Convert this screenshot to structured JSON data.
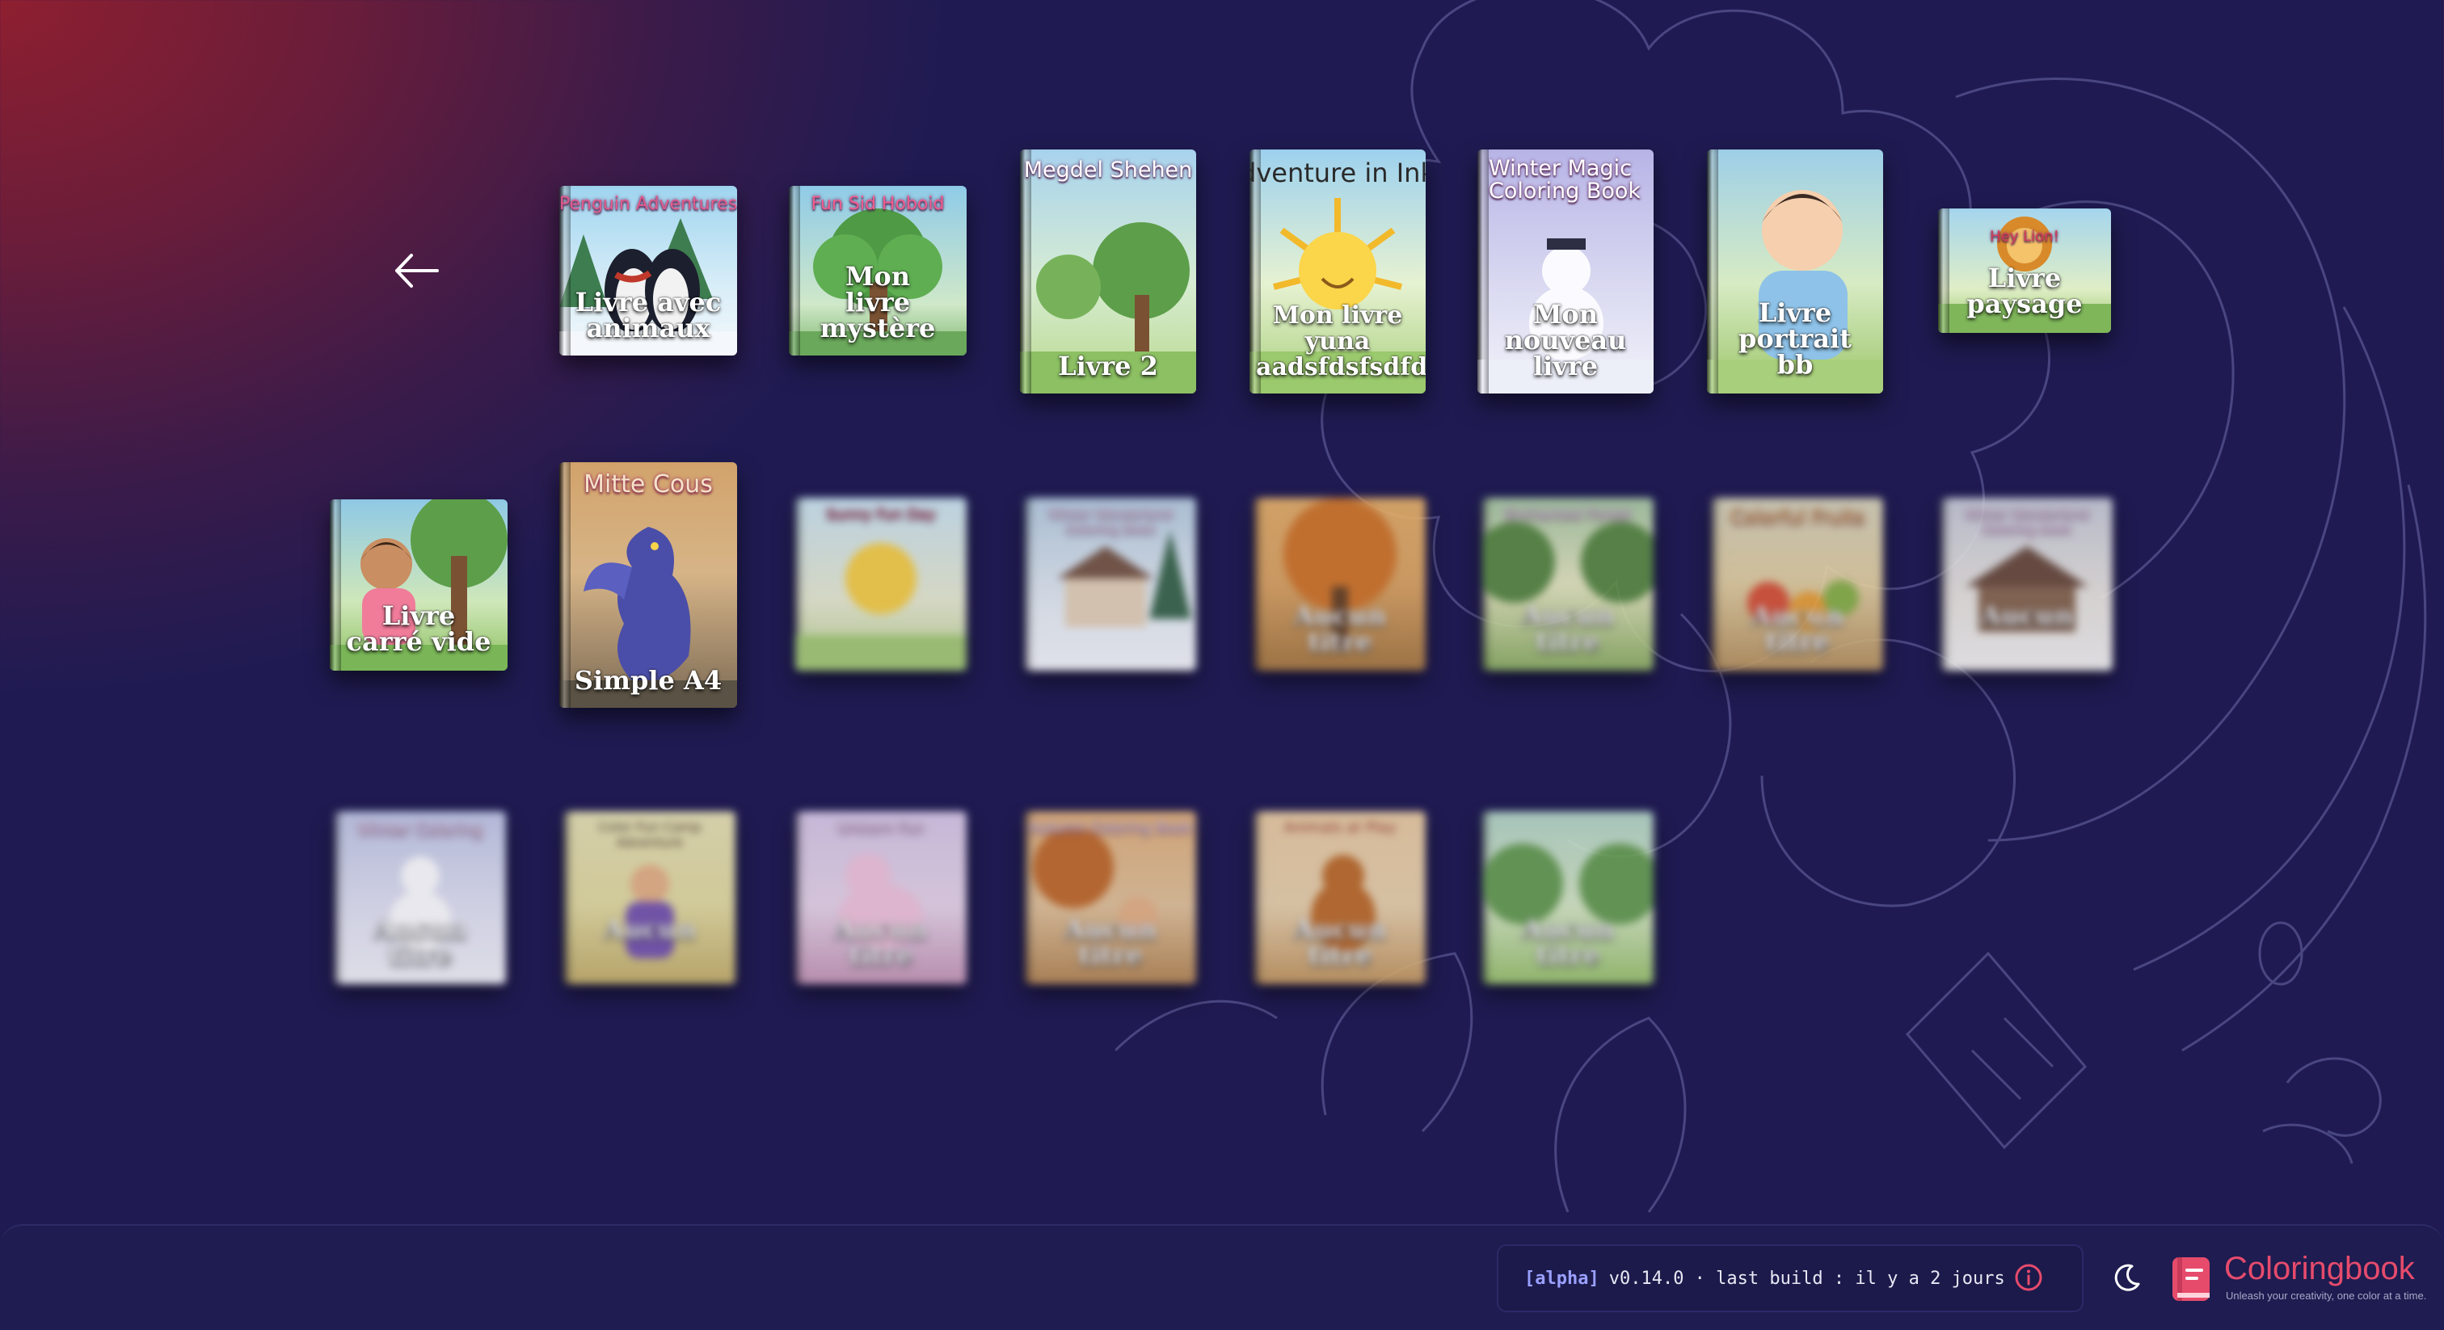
{
  "back_label": "back",
  "books": {
    "row1": [
      {
        "label": "Livre avec\nanimaux",
        "cover_title": "Penguin Adventures"
      },
      {
        "label": "Mon\nlivre\nmystère",
        "cover_title": "Fun Sid Hoboid"
      },
      {
        "label": "Livre 2",
        "cover_title": "Megdel Shehen"
      },
      {
        "label": "Mon livre\nyuna\naadsfdsfsdfds",
        "cover_title": "dventure in Ink"
      },
      {
        "label": "Mon\nnouveau\nlivre",
        "cover_title": "Winter Magic\nColoring Book"
      },
      {
        "label": "Livre\nportrait\nbb",
        "cover_title": ""
      },
      {
        "label": "Livre\npaysage",
        "cover_title": "Hey Lion!"
      }
    ],
    "row2": [
      {
        "label": "Livre\ncarré vide",
        "cover_title": ""
      },
      {
        "label": "Simple A4",
        "cover_title": "Mitte Cous"
      },
      {
        "label": "",
        "cover_title": "Sunny Fun Day"
      },
      {
        "label": "",
        "cover_title": "Winter Wonderland Coloring Book"
      },
      {
        "label": "Aucun titre",
        "cover_title": ""
      },
      {
        "label": "Aucun titre",
        "cover_title": "Enchanted Forest"
      },
      {
        "label": "Aucun titre",
        "cover_title": "Colorful Fruits"
      },
      {
        "label": "Aucun",
        "cover_title": "Winter Wonderland Coloring book"
      }
    ],
    "row3": [
      {
        "label": "Aucun titre",
        "cover_title": "Winter Coloring"
      },
      {
        "label": "Aucun",
        "cover_title": "Color Fun Camp Adventure"
      },
      {
        "label": "Aucun titre",
        "cover_title": "Unicorn Fun"
      },
      {
        "label": "Aucun titre",
        "cover_title": "Autumn Coloring Book"
      },
      {
        "label": "Aucun titre",
        "cover_title": "Animals at Play"
      },
      {
        "label": "Aucun titre",
        "cover_title": ""
      }
    ]
  },
  "footer": {
    "alpha_tag": "[alpha]",
    "version_text": "v0.14.0 · last build : il y a 2 jours",
    "brand_name": "Coloringbook",
    "brand_tagline": "Unleash your creativity, one color at a time."
  },
  "icons": {
    "back": "arrow-left-icon",
    "info": "info-icon",
    "theme": "moon-icon",
    "brand": "book-logo-icon"
  },
  "colors": {
    "accent": "#e64b6c",
    "alpha": "#9aa0ff",
    "background": "#1f1b52"
  }
}
